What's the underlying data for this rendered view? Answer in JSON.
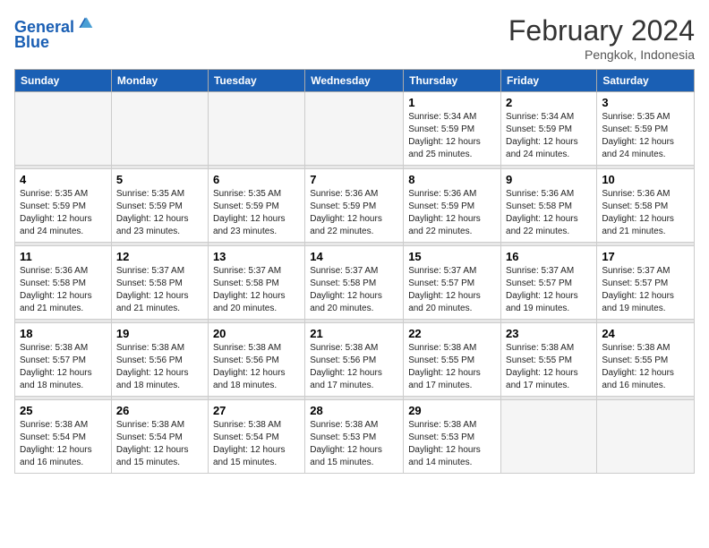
{
  "header": {
    "logo_line1": "General",
    "logo_line2": "Blue",
    "month_year": "February 2024",
    "location": "Pengkok, Indonesia"
  },
  "days_of_week": [
    "Sunday",
    "Monday",
    "Tuesday",
    "Wednesday",
    "Thursday",
    "Friday",
    "Saturday"
  ],
  "weeks": [
    [
      {
        "day": "",
        "info": ""
      },
      {
        "day": "",
        "info": ""
      },
      {
        "day": "",
        "info": ""
      },
      {
        "day": "",
        "info": ""
      },
      {
        "day": "1",
        "info": "Sunrise: 5:34 AM\nSunset: 5:59 PM\nDaylight: 12 hours\nand 25 minutes."
      },
      {
        "day": "2",
        "info": "Sunrise: 5:34 AM\nSunset: 5:59 PM\nDaylight: 12 hours\nand 24 minutes."
      },
      {
        "day": "3",
        "info": "Sunrise: 5:35 AM\nSunset: 5:59 PM\nDaylight: 12 hours\nand 24 minutes."
      }
    ],
    [
      {
        "day": "4",
        "info": "Sunrise: 5:35 AM\nSunset: 5:59 PM\nDaylight: 12 hours\nand 24 minutes."
      },
      {
        "day": "5",
        "info": "Sunrise: 5:35 AM\nSunset: 5:59 PM\nDaylight: 12 hours\nand 23 minutes."
      },
      {
        "day": "6",
        "info": "Sunrise: 5:35 AM\nSunset: 5:59 PM\nDaylight: 12 hours\nand 23 minutes."
      },
      {
        "day": "7",
        "info": "Sunrise: 5:36 AM\nSunset: 5:59 PM\nDaylight: 12 hours\nand 22 minutes."
      },
      {
        "day": "8",
        "info": "Sunrise: 5:36 AM\nSunset: 5:59 PM\nDaylight: 12 hours\nand 22 minutes."
      },
      {
        "day": "9",
        "info": "Sunrise: 5:36 AM\nSunset: 5:58 PM\nDaylight: 12 hours\nand 22 minutes."
      },
      {
        "day": "10",
        "info": "Sunrise: 5:36 AM\nSunset: 5:58 PM\nDaylight: 12 hours\nand 21 minutes."
      }
    ],
    [
      {
        "day": "11",
        "info": "Sunrise: 5:36 AM\nSunset: 5:58 PM\nDaylight: 12 hours\nand 21 minutes."
      },
      {
        "day": "12",
        "info": "Sunrise: 5:37 AM\nSunset: 5:58 PM\nDaylight: 12 hours\nand 21 minutes."
      },
      {
        "day": "13",
        "info": "Sunrise: 5:37 AM\nSunset: 5:58 PM\nDaylight: 12 hours\nand 20 minutes."
      },
      {
        "day": "14",
        "info": "Sunrise: 5:37 AM\nSunset: 5:58 PM\nDaylight: 12 hours\nand 20 minutes."
      },
      {
        "day": "15",
        "info": "Sunrise: 5:37 AM\nSunset: 5:57 PM\nDaylight: 12 hours\nand 20 minutes."
      },
      {
        "day": "16",
        "info": "Sunrise: 5:37 AM\nSunset: 5:57 PM\nDaylight: 12 hours\nand 19 minutes."
      },
      {
        "day": "17",
        "info": "Sunrise: 5:37 AM\nSunset: 5:57 PM\nDaylight: 12 hours\nand 19 minutes."
      }
    ],
    [
      {
        "day": "18",
        "info": "Sunrise: 5:38 AM\nSunset: 5:57 PM\nDaylight: 12 hours\nand 18 minutes."
      },
      {
        "day": "19",
        "info": "Sunrise: 5:38 AM\nSunset: 5:56 PM\nDaylight: 12 hours\nand 18 minutes."
      },
      {
        "day": "20",
        "info": "Sunrise: 5:38 AM\nSunset: 5:56 PM\nDaylight: 12 hours\nand 18 minutes."
      },
      {
        "day": "21",
        "info": "Sunrise: 5:38 AM\nSunset: 5:56 PM\nDaylight: 12 hours\nand 17 minutes."
      },
      {
        "day": "22",
        "info": "Sunrise: 5:38 AM\nSunset: 5:55 PM\nDaylight: 12 hours\nand 17 minutes."
      },
      {
        "day": "23",
        "info": "Sunrise: 5:38 AM\nSunset: 5:55 PM\nDaylight: 12 hours\nand 17 minutes."
      },
      {
        "day": "24",
        "info": "Sunrise: 5:38 AM\nSunset: 5:55 PM\nDaylight: 12 hours\nand 16 minutes."
      }
    ],
    [
      {
        "day": "25",
        "info": "Sunrise: 5:38 AM\nSunset: 5:54 PM\nDaylight: 12 hours\nand 16 minutes."
      },
      {
        "day": "26",
        "info": "Sunrise: 5:38 AM\nSunset: 5:54 PM\nDaylight: 12 hours\nand 15 minutes."
      },
      {
        "day": "27",
        "info": "Sunrise: 5:38 AM\nSunset: 5:54 PM\nDaylight: 12 hours\nand 15 minutes."
      },
      {
        "day": "28",
        "info": "Sunrise: 5:38 AM\nSunset: 5:53 PM\nDaylight: 12 hours\nand 15 minutes."
      },
      {
        "day": "29",
        "info": "Sunrise: 5:38 AM\nSunset: 5:53 PM\nDaylight: 12 hours\nand 14 minutes."
      },
      {
        "day": "",
        "info": ""
      },
      {
        "day": "",
        "info": ""
      }
    ]
  ]
}
